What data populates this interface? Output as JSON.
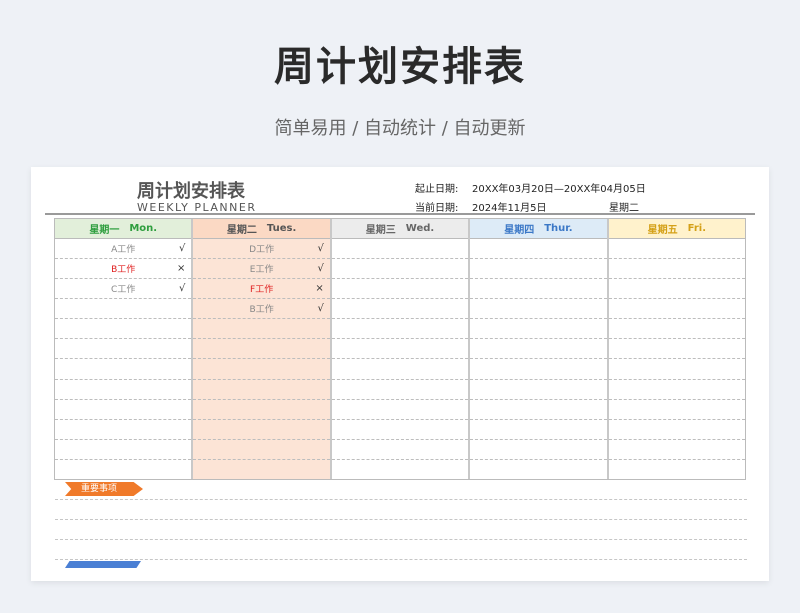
{
  "banner": {
    "title": "周计划安排表",
    "subtitle": "简单易用  /  自动统计  /  自动更新"
  },
  "sheet": {
    "title": "周计划安排表",
    "subtitle": "WEEKLY  PLANNER",
    "range_label": "起止日期:",
    "range_value": "20XX年03月20日—20XX年04月05日",
    "current_label": "当前日期:",
    "current_value": "2024年11月5日",
    "weekday_value": "星期二"
  },
  "columns": [
    {
      "cn": "星期一",
      "en": "Mon.",
      "text_color": "#2e9e3e",
      "bg": "#e2efda",
      "body_bg": "#ffffff",
      "tasks": [
        {
          "name": "A工作",
          "mark": "√",
          "red": false
        },
        {
          "name": "B工作",
          "mark": "×",
          "red": true
        },
        {
          "name": "C工作",
          "mark": "√",
          "red": false
        }
      ]
    },
    {
      "cn": "星期二",
      "en": "Tues.",
      "text_color": "#555555",
      "bg": "#fbd9c4",
      "body_bg": "#fce4d6",
      "tasks": [
        {
          "name": "D工作",
          "mark": "√",
          "red": false
        },
        {
          "name": "E工作",
          "mark": "√",
          "red": false
        },
        {
          "name": "F工作",
          "mark": "×",
          "red": true
        },
        {
          "name": "B工作",
          "mark": "√",
          "red": false
        }
      ]
    },
    {
      "cn": "星期三",
      "en": "Wed.",
      "text_color": "#666666",
      "bg": "#ececec",
      "body_bg": "#ffffff",
      "tasks": []
    },
    {
      "cn": "星期四",
      "en": "Thur.",
      "text_color": "#3b78c7",
      "bg": "#ddebf7",
      "body_bg": "#ffffff",
      "tasks": []
    },
    {
      "cn": "星期五",
      "en": "Fri.",
      "text_color": "#d4a017",
      "bg": "#fff2cc",
      "body_bg": "#ffffff",
      "tasks": []
    }
  ],
  "important": {
    "label": "重要事项"
  }
}
